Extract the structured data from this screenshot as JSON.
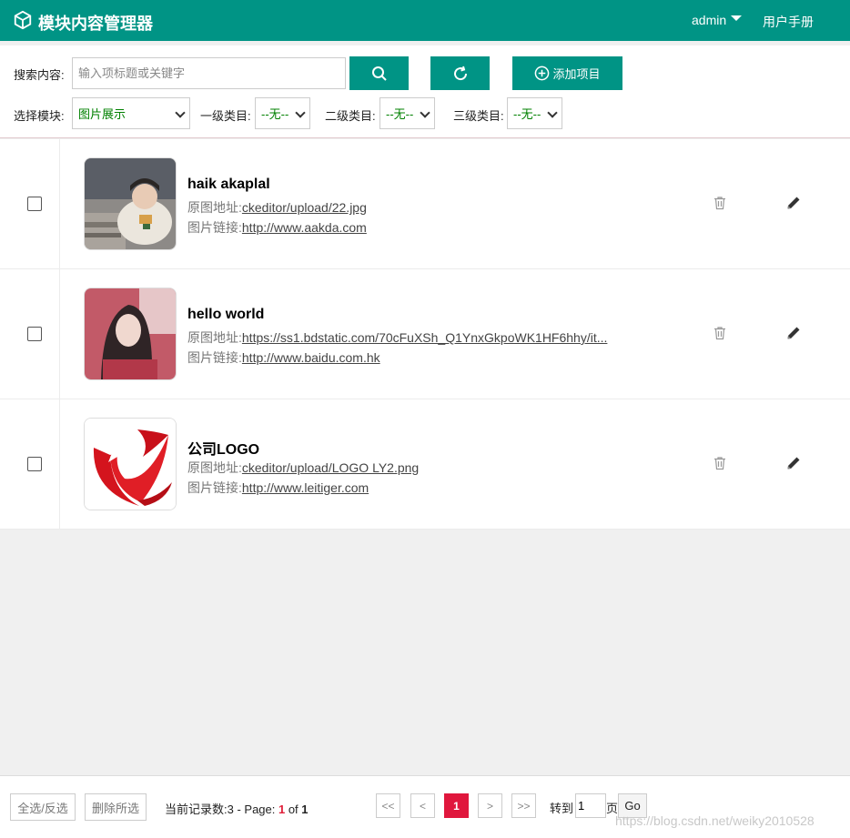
{
  "header": {
    "title": "模块内容管理器",
    "user": "admin",
    "manual": "用户手册"
  },
  "toolbar": {
    "search_label": "搜索内容:",
    "search_placeholder": "输入项标题或关键字",
    "add_label": "添加项目",
    "module_label": "选择模块:",
    "module_value": "图片展示",
    "cat1_label": "一级类目:",
    "cat1_value": "--无--",
    "cat2_label": "二级类目:",
    "cat2_value": "--无--",
    "cat3_label": "三级类目:",
    "cat3_value": "--无--"
  },
  "items": [
    {
      "title": "haik akaplal",
      "src_label": "原图地址:",
      "src_value": "ckeditor/upload/22.jpg",
      "link_label": "图片链接:",
      "link_value": "http://www.aakda.com"
    },
    {
      "title": "hello world",
      "src_label": "原图地址:",
      "src_value": "https://ss1.bdstatic.com/70cFuXSh_Q1YnxGkpoWK1HF6hhy/it...",
      "link_label": "图片链接:",
      "link_value": "http://www.baidu.com.hk"
    },
    {
      "title": "公司LOGO",
      "src_label": "原图地址:",
      "src_value": "ckeditor/upload/LOGO LY2.png",
      "link_label": "图片链接:",
      "link_value": "http://www.leitiger.com"
    }
  ],
  "footer": {
    "select_all": "全选/反选",
    "delete_selected": "删除所选",
    "records_prefix": "当前记录数:3 - Page: ",
    "current_page": "1",
    "of_text": " of ",
    "total_pages": "1",
    "first": "<<",
    "prev": "<",
    "page1": "1",
    "next": ">",
    "last": ">>",
    "goto_label": "转到",
    "page_input": "1",
    "page_unit": "页",
    "go": "Go",
    "watermark": "https://blog.csdn.net/weiky2010528"
  },
  "colors": {
    "brand": "#009485",
    "active_page": "#e0173d",
    "select_text": "#008000"
  }
}
